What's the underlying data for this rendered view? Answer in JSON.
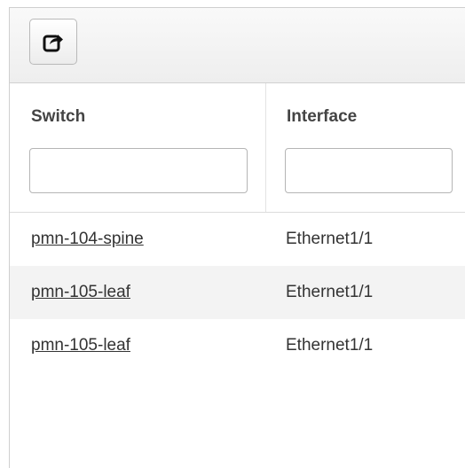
{
  "toolbar": {
    "export_icon": "share-external-icon"
  },
  "table": {
    "columns": [
      {
        "label": "Switch",
        "filter_value": "",
        "filter_placeholder": ""
      },
      {
        "label": "Interface",
        "filter_value": "",
        "filter_placeholder": ""
      }
    ],
    "rows": [
      {
        "switch": "pmn-104-spine",
        "interface": "Ethernet1/1"
      },
      {
        "switch": "pmn-105-leaf",
        "interface": "Ethernet1/1"
      },
      {
        "switch": "pmn-105-leaf",
        "interface": "Ethernet1/1"
      }
    ]
  }
}
